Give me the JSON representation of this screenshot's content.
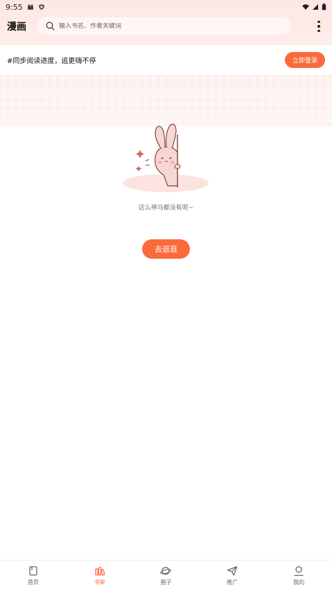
{
  "status_bar": {
    "time": "9:55"
  },
  "header": {
    "title": "漫画",
    "search_placeholder": "输入书名、作者关键词"
  },
  "login_banner": {
    "text": "#同步阅读进度，追更嗨不停",
    "button_label": "立即登录"
  },
  "empty_state": {
    "message": "这么神马都没有呢~",
    "button_label": "去逛逛"
  },
  "tabs": [
    {
      "label": "首页",
      "icon": "book-icon",
      "active": false
    },
    {
      "label": "书架",
      "icon": "bookshelf-icon",
      "active": true
    },
    {
      "label": "圈子",
      "icon": "planet-icon",
      "active": false
    },
    {
      "label": "推广",
      "icon": "paper-plane-icon",
      "active": false
    },
    {
      "label": "我的",
      "icon": "user-icon",
      "active": false
    }
  ],
  "colors": {
    "accent": "#fb6a3b",
    "header_bg": "#fde7e3"
  }
}
